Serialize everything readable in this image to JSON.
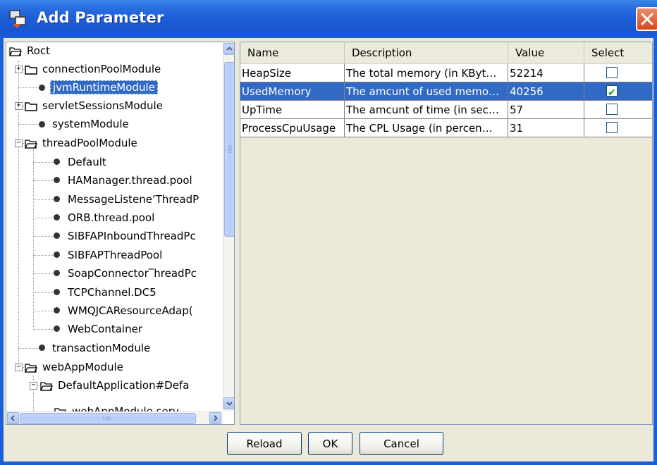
{
  "window": {
    "title": "Add Parameter"
  },
  "tree": {
    "nodes": [
      {
        "label": "Roct"
      },
      {
        "label": "connectionPoolModule"
      },
      {
        "label": "jvmRuntimeModule"
      },
      {
        "label": "servletSessionsModule"
      },
      {
        "label": "systemModule"
      },
      {
        "label": "threadPoolModule"
      },
      {
        "label": "Default"
      },
      {
        "label": "HAManager.thread.pool"
      },
      {
        "label": "MessageListene’ThreadP"
      },
      {
        "label": "ORB.thread.pool"
      },
      {
        "label": "SIBFAPInboundThreadPс"
      },
      {
        "label": "SIBFAPThreadPool"
      },
      {
        "label": "SoapConnector‾hreadPc"
      },
      {
        "label": "TCPChannel.DC5"
      },
      {
        "label": "WMQJCAResourceAdap("
      },
      {
        "label": "WebContainer"
      },
      {
        "label": "transactionModule"
      },
      {
        "label": "webAppModule"
      },
      {
        "label": "DefaultApplication#Defa"
      },
      {
        "label": "webAppModule.serv"
      }
    ]
  },
  "table": {
    "columns": [
      "Name",
      "Description",
      "Value",
      "Select"
    ],
    "rows": [
      {
        "name": "HeapSize",
        "description": "The total memory (in KByt…",
        "value": "52214",
        "selected": false
      },
      {
        "name": "UsedMemory",
        "description": "The amcunt of used memo…",
        "value": "40256",
        "selected": true
      },
      {
        "name": "UpTime",
        "description": "The amcunt of time (in sec…",
        "value": "57",
        "selected": false
      },
      {
        "name": "ProcessCpuUsage",
        "description": "The CPL Usage (in percen…",
        "value": "31",
        "selected": false
      }
    ]
  },
  "buttons": {
    "reload": "Reload",
    "ok": "OK",
    "cancel": "Cancel"
  },
  "colors": {
    "title_bar": "#1d5ed8",
    "selection": "#316ac5",
    "close_button": "#d44a1a"
  }
}
